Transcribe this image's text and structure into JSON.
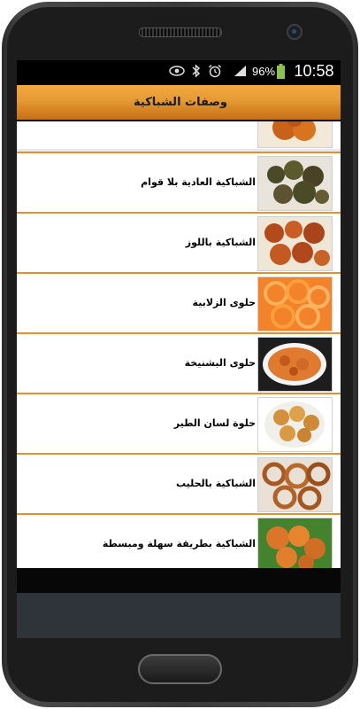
{
  "status_bar": {
    "battery_percent": "96%",
    "time": "10:58",
    "icons": [
      "eye-icon",
      "bluetooth-icon",
      "alarm-icon",
      "signal-icon",
      "battery-icon"
    ]
  },
  "header": {
    "title": "وصفات الشباكية",
    "color": "#e5992f"
  },
  "list": {
    "partial_item_label": "…",
    "items": [
      {
        "label": "الشباكية العادية بلا قوام"
      },
      {
        "label": "الشباكية باللوز"
      },
      {
        "label": "حلوى الزلابية"
      },
      {
        "label": "حلوى البشنيخة"
      },
      {
        "label": "حلوة لسان الطير"
      },
      {
        "label": "الشباكية بالحليب"
      },
      {
        "label": "الشباكية بطريقة سهلة ومبسطة"
      }
    ]
  }
}
